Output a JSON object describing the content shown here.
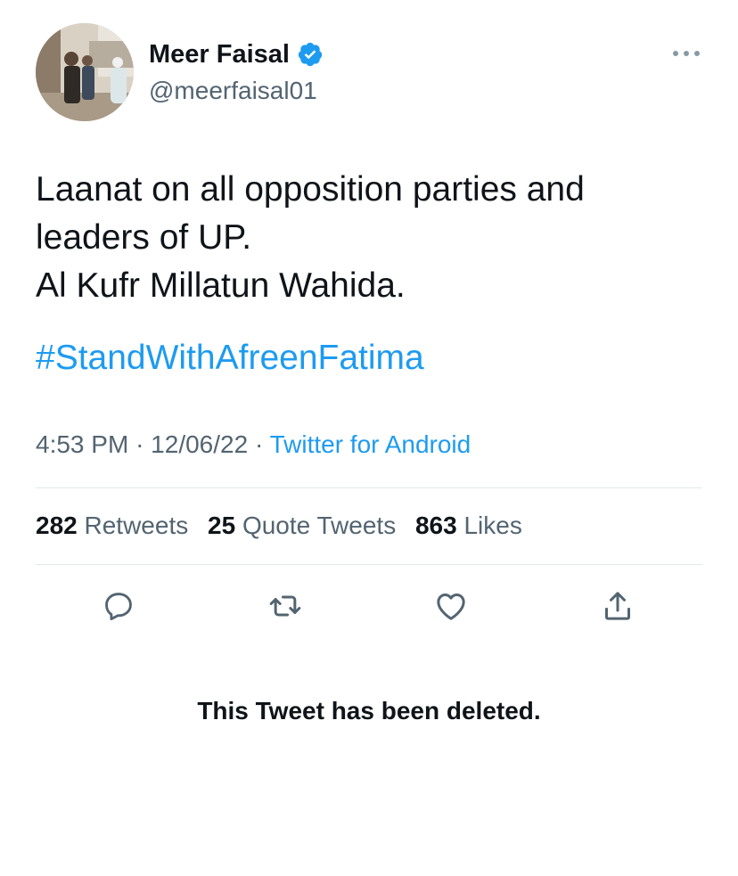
{
  "author": {
    "display_name": "Meer Faisal",
    "handle": "@meerfaisal01",
    "verified": true,
    "avatar": "avatar-photo"
  },
  "tweet": {
    "lines": [
      "Laanat on all opposition parties and",
      "leaders of UP.",
      "Al Kufr Millatun Wahida."
    ],
    "hashtag": "#StandWithAfreenFatima",
    "time": "4:53 PM",
    "separator": "·",
    "date": "12/06/22",
    "source": "Twitter for Android"
  },
  "stats": {
    "retweets": {
      "count": "282",
      "label": "Retweets"
    },
    "quote_tweets": {
      "count": "25",
      "label": "Quote Tweets"
    },
    "likes": {
      "count": "863",
      "label": "Likes"
    }
  },
  "actions": [
    {
      "icon": "reply-icon"
    },
    {
      "icon": "retweet-icon"
    },
    {
      "icon": "like-icon"
    },
    {
      "icon": "share-icon"
    }
  ],
  "notice": "This Tweet has been deleted.",
  "colors": {
    "link": "#1d9bf0",
    "secondary_text": "#536471",
    "primary_text": "#0f1419",
    "divider": "#e1e8ed",
    "icon": "#536471"
  }
}
